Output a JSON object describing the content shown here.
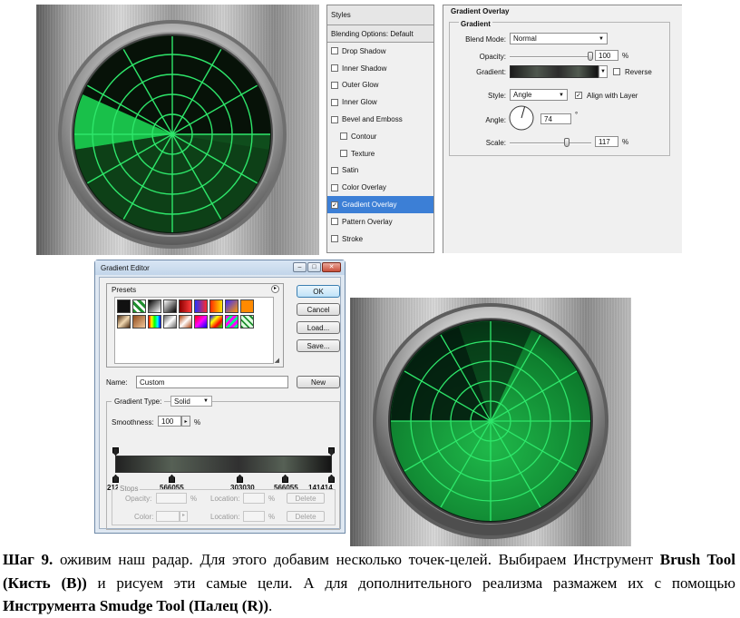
{
  "layer_style": {
    "styles_label": "Styles",
    "blending_label": "Blending Options: Default",
    "effects": [
      {
        "label": "Drop Shadow",
        "checked": false,
        "indent": false
      },
      {
        "label": "Inner Shadow",
        "checked": false,
        "indent": false
      },
      {
        "label": "Outer Glow",
        "checked": false,
        "indent": false
      },
      {
        "label": "Inner Glow",
        "checked": false,
        "indent": false
      },
      {
        "label": "Bevel and Emboss",
        "checked": false,
        "indent": false
      },
      {
        "label": "Contour",
        "checked": false,
        "indent": true
      },
      {
        "label": "Texture",
        "checked": false,
        "indent": true
      },
      {
        "label": "Satin",
        "checked": false,
        "indent": false
      },
      {
        "label": "Color Overlay",
        "checked": false,
        "indent": false
      },
      {
        "label": "Gradient Overlay",
        "checked": true,
        "indent": false,
        "selected": true
      },
      {
        "label": "Pattern Overlay",
        "checked": false,
        "indent": false
      },
      {
        "label": "Stroke",
        "checked": false,
        "indent": false
      }
    ],
    "panel_title": "Gradient Overlay",
    "group_title": "Gradient",
    "blend_mode_label": "Blend Mode:",
    "blend_mode_value": "Normal",
    "opacity_label": "Opacity:",
    "opacity_value": "100",
    "opacity_unit": "%",
    "gradient_label": "Gradient:",
    "reverse_label": "Reverse",
    "style_label": "Style:",
    "style_value": "Angle",
    "align_label": "Align with Layer",
    "angle_label": "Angle:",
    "angle_value": "74",
    "angle_unit": "°",
    "scale_label": "Scale:",
    "scale_value": "117",
    "scale_unit": "%"
  },
  "gradient_editor": {
    "title": "Gradient Editor",
    "presets_label": "Presets",
    "ok_label": "OK",
    "cancel_label": "Cancel",
    "load_label": "Load...",
    "save_label": "Save...",
    "name_label": "Name:",
    "name_value": "Custom",
    "new_label": "New",
    "gradient_type_label": "Gradient Type:",
    "gradient_type_value": "Solid",
    "smoothness_label": "Smoothness:",
    "smoothness_value": "100",
    "smoothness_unit": "%",
    "color_stops": [
      "212121",
      "566055",
      "303030",
      "566055",
      "141414"
    ],
    "stops_label": "Stops",
    "opacity_label": "Opacity:",
    "location_label": "Location:",
    "color_label": "Color:",
    "percent": "%",
    "delete_label": "Delete"
  },
  "caption": {
    "step": "Шаг 9.",
    "text1": " оживим наш радар. Для этого добавим несколько точек-целей. Выбираем Инструмент ",
    "tool1": "Brush Tool (Кисть (B))",
    "text2": " и рисуем эти самые цели. А для дополнительного реализма размажем их с помощью ",
    "tool2": "Инструмента Smudge Tool (Палец (R))",
    "text3": "."
  },
  "colors": {
    "radar_green": "#19c04a",
    "radar_line": "#2ee66a",
    "selection": "#3c7fd6"
  }
}
